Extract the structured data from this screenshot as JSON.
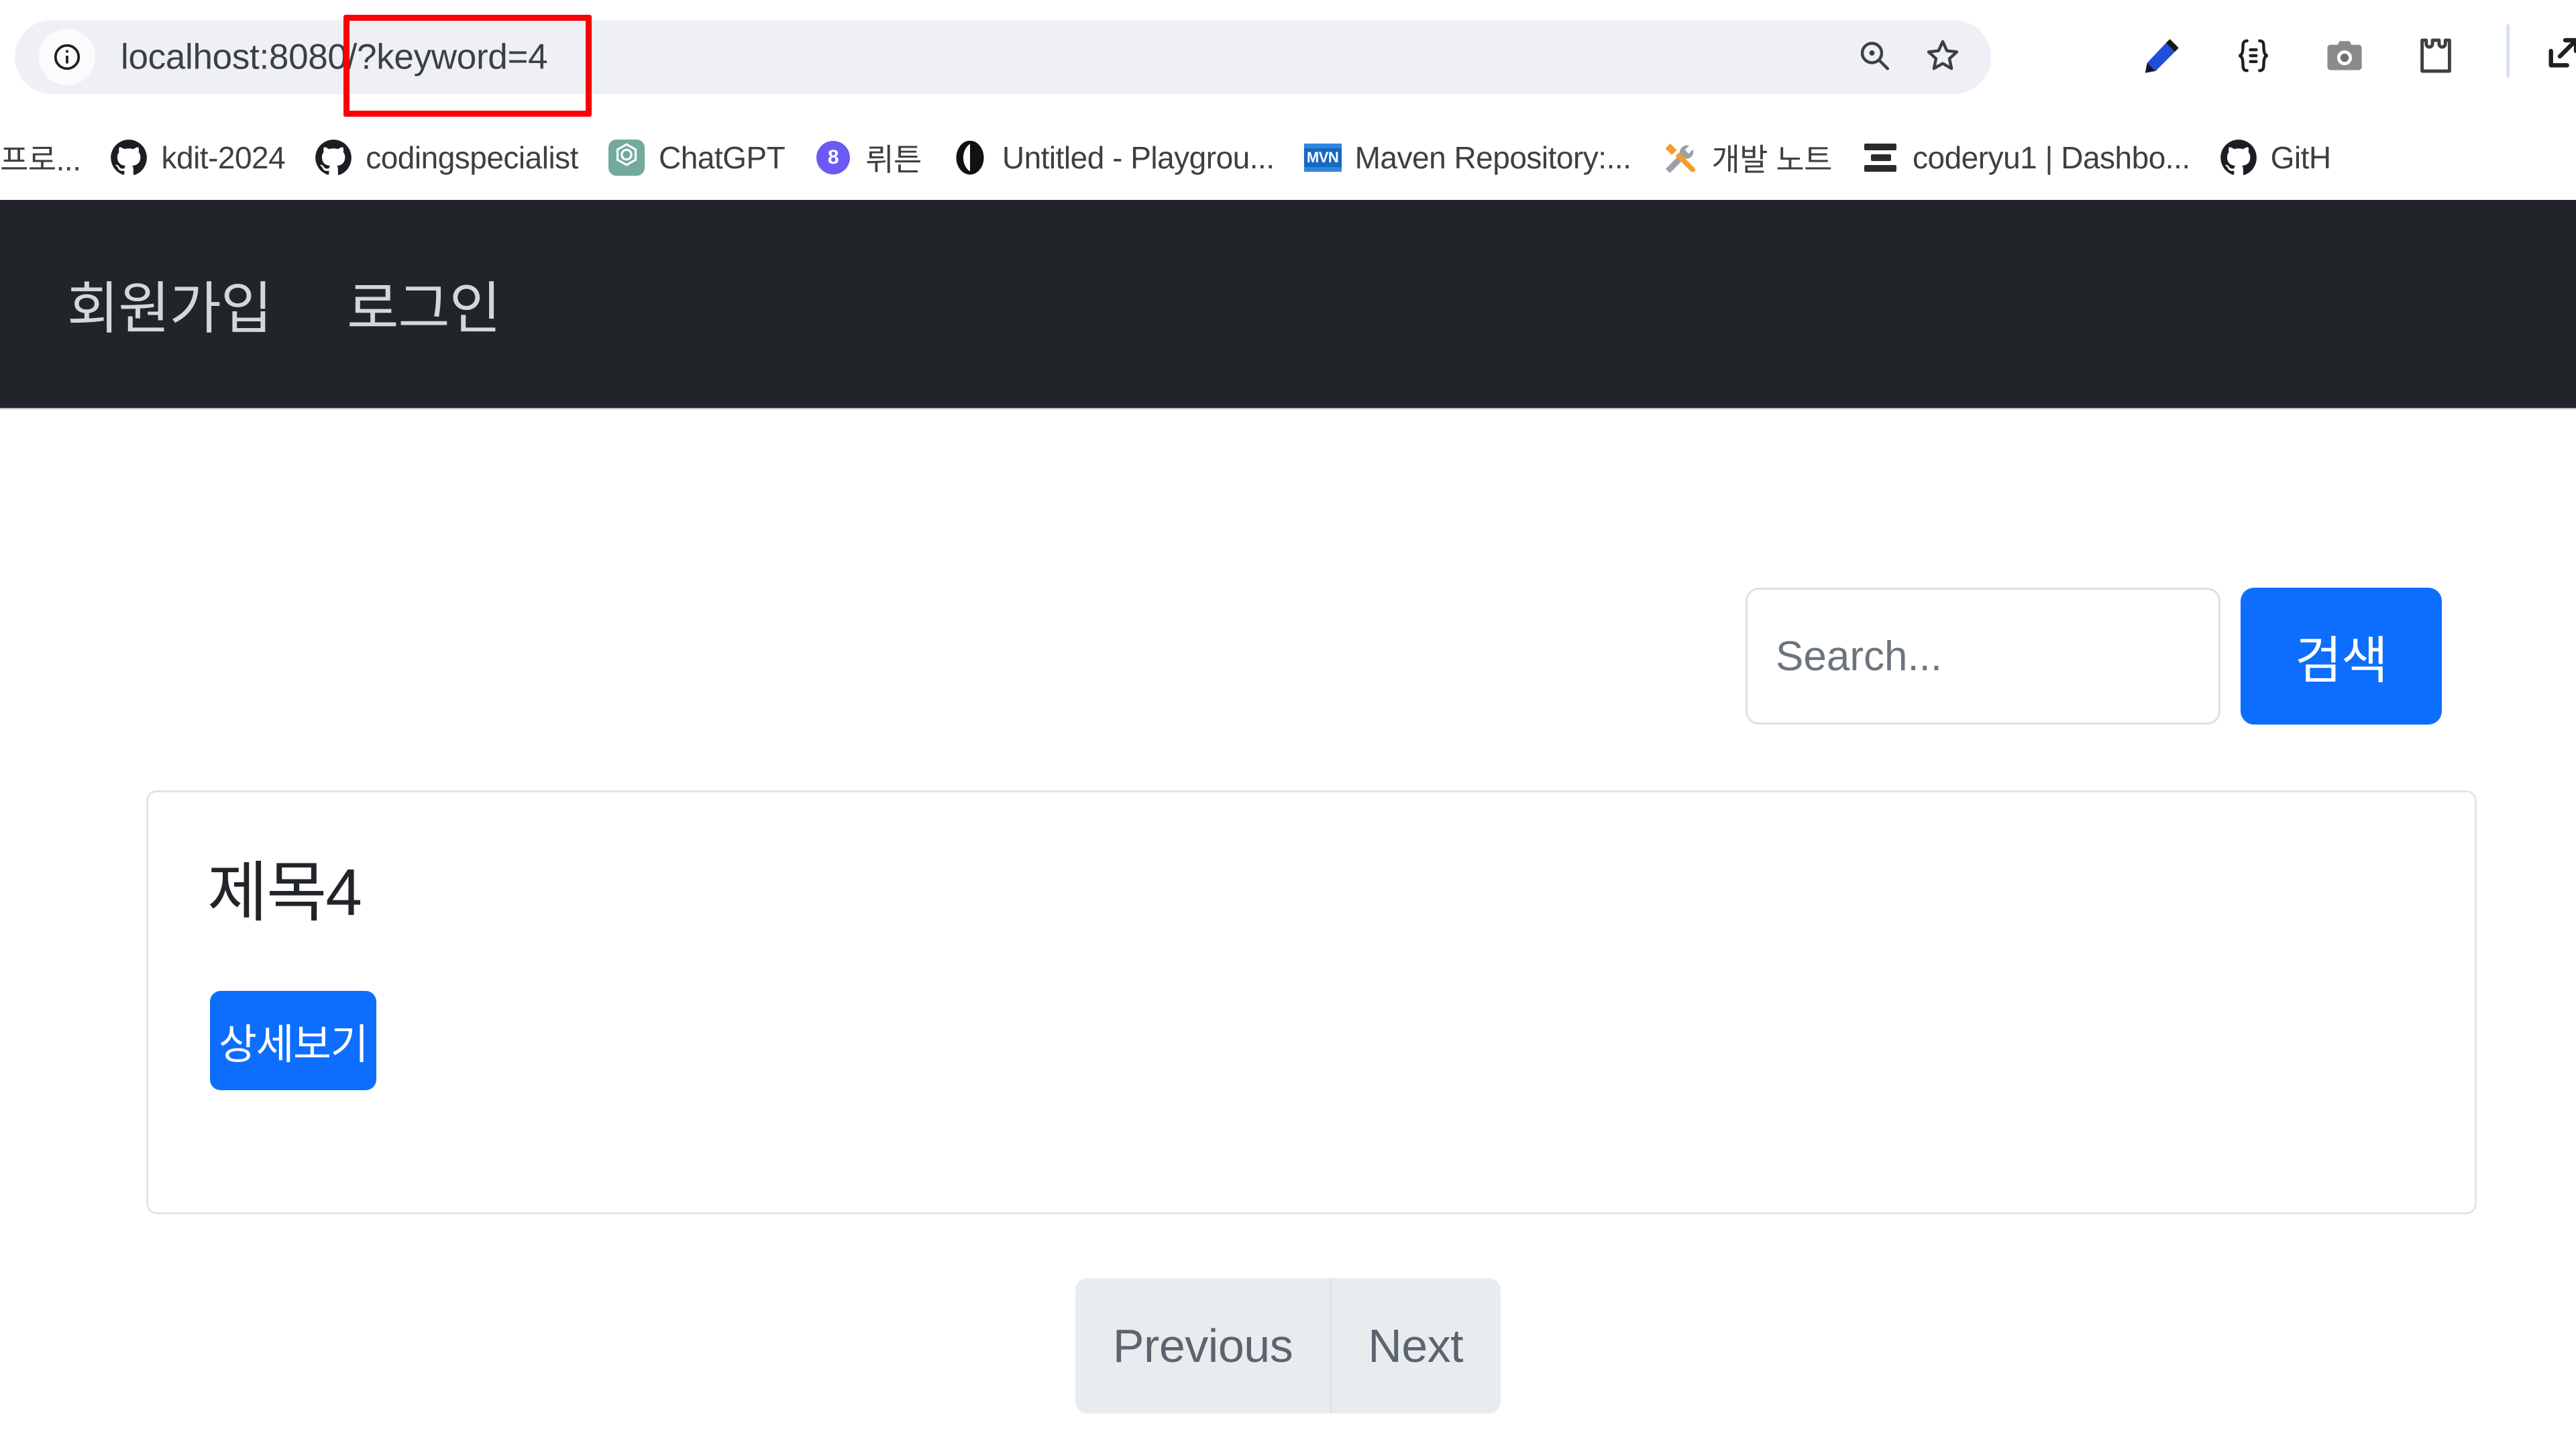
{
  "browser": {
    "omnibox": {
      "site_info_icon": "info-circle-icon",
      "url_base": "localhost:8080/",
      "url_query": "?keyword=4",
      "full_url": "localhost:8080/?keyword=4",
      "inline_icons": [
        "page-zoom-icon",
        "bookmark-star-icon"
      ]
    },
    "toolbar_icons": [
      "pen-marker-icon",
      "code-braces-icon",
      "camera-icon",
      "extensions-puzzle-icon",
      "download-arrow-icon"
    ],
    "annotation": {
      "type": "rectangle",
      "color": "#fb0007",
      "target_text": "?keyword=4"
    },
    "bookmarks": [
      {
        "label": "프로...",
        "icon": "korean-text-icon"
      },
      {
        "label": "kdit-2024",
        "icon": "github-icon"
      },
      {
        "label": "codingspecialist",
        "icon": "github-icon"
      },
      {
        "label": "ChatGPT",
        "icon": "chatgpt-icon"
      },
      {
        "label": "뤼튼",
        "icon": "wrtn-icon"
      },
      {
        "label": "Untitled - Playgrou...",
        "icon": "playground-icon"
      },
      {
        "label": "Maven Repository:...",
        "icon": "maven-icon"
      },
      {
        "label": "개발 노트",
        "icon": "tools-icon"
      },
      {
        "label": "coderyu1 | Dashbo...",
        "icon": "notion-icon"
      },
      {
        "label": "GitH",
        "icon": "github-icon"
      }
    ]
  },
  "page": {
    "navbar": {
      "background": "#212529",
      "links": [
        {
          "label": "회원가입"
        },
        {
          "label": "로그인"
        }
      ]
    },
    "search": {
      "value": "",
      "placeholder": "Search...",
      "button_label": "검색",
      "button_color": "#0d6efd"
    },
    "posts": [
      {
        "title": "제목4",
        "detail_button_label": "상세보기"
      }
    ],
    "pagination": {
      "previous_label": "Previous",
      "next_label": "Next"
    }
  }
}
